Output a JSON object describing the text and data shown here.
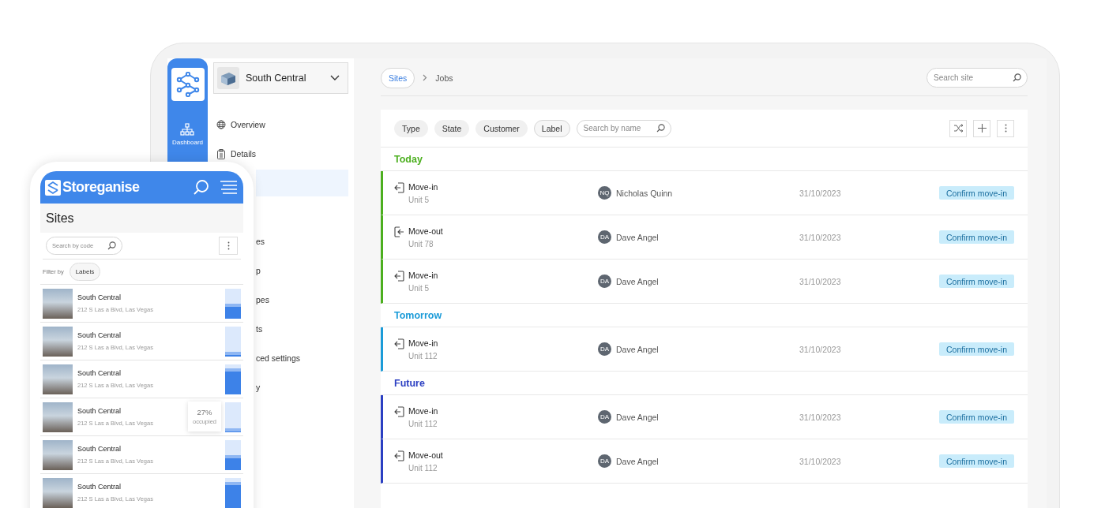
{
  "tablet": {
    "rail": {
      "item": "Dashboard"
    },
    "site_selector": {
      "name": "South Central"
    },
    "nav": [
      {
        "label": "Overview",
        "kind": "globe",
        "selected": false
      },
      {
        "label": "Details",
        "kind": "clipboard",
        "selected": false
      },
      {
        "selected": true
      },
      {
        "label": "es",
        "selected": false
      },
      {
        "label": "p",
        "selected": false
      },
      {
        "label": "pes",
        "selected": false
      },
      {
        "label": "ts",
        "selected": false
      },
      {
        "label": "ced settings",
        "selected": false
      },
      {
        "label": "y",
        "selected": false
      }
    ],
    "breadcrumb": {
      "link": "Sites",
      "current": "Jobs"
    },
    "search_site": {
      "placeholder": "Search site"
    },
    "filters": [
      {
        "label": "Type",
        "selected": false
      },
      {
        "label": "State",
        "selected": false
      },
      {
        "label": "Customer",
        "selected": false
      },
      {
        "label": "Label",
        "selected": true
      }
    ],
    "search_name": {
      "placeholder": "Search by name"
    },
    "groups": [
      {
        "title": "Today",
        "color": "#4caf1f",
        "jobs": [
          {
            "kind": "enter",
            "type": "Move-in",
            "unit": "Unit 5",
            "initials": "NQ",
            "customer": "Nicholas Quinn",
            "date": "31/10/2023",
            "action": "Confirm move-in"
          },
          {
            "kind": "exit",
            "type": "Move-out",
            "unit": "Unit 78",
            "initials": "DA",
            "customer": "Dave Angel",
            "date": "31/10/2023",
            "action": "Confirm move-in"
          },
          {
            "kind": "enter",
            "type": "Move-in",
            "unit": "Unit 5",
            "initials": "DA",
            "customer": "Dave Angel",
            "date": "31/10/2023",
            "action": "Confirm move-in"
          }
        ]
      },
      {
        "title": "Tomorrow",
        "color": "#1b9bd8",
        "jobs": [
          {
            "kind": "enter",
            "type": "Move-in",
            "unit": "Unit 112",
            "initials": "DA",
            "customer": "Dave Angel",
            "date": "31/10/2023",
            "action": "Confirm move-in"
          }
        ]
      },
      {
        "title": "Future",
        "color": "#2b3fc2",
        "jobs": [
          {
            "kind": "enter",
            "type": "Move-in",
            "unit": "Unit 112",
            "initials": "DA",
            "customer": "Dave Angel",
            "date": "31/10/2023",
            "action": "Confirm move-in"
          },
          {
            "kind": "enter",
            "type": "Move-out",
            "unit": "Unit 112",
            "initials": "DA",
            "customer": "Dave Angel",
            "date": "31/10/2023",
            "action": "Confirm move-in"
          }
        ]
      }
    ]
  },
  "phone": {
    "brand": "Storeganise",
    "title": "Sites",
    "search": {
      "placeholder": "Search by code"
    },
    "filter_label": "Filter by",
    "filter_chip": "Labels",
    "sites": [
      {
        "name": "South Central",
        "address": "212 S Las a Blvd, Las Vegas",
        "level": 0.5
      },
      {
        "name": "South Central",
        "address": "212 S Las a Blvd, Las Vegas",
        "level": 0.15
      },
      {
        "name": "South Central",
        "address": "212 S Las a Blvd, Las Vegas",
        "level": 0.85
      },
      {
        "name": "South Central",
        "address": "212 S Las a Blvd, Las Vegas",
        "level": 0.12,
        "tooltip": {
          "value": "27%",
          "caption": "occupied"
        }
      },
      {
        "name": "South Central",
        "address": "212 S Las a Blvd, Las Vegas",
        "level": 0.5
      },
      {
        "name": "South Central",
        "address": "212 S Las a Blvd, Las Vegas",
        "level": 0.85
      }
    ]
  }
}
